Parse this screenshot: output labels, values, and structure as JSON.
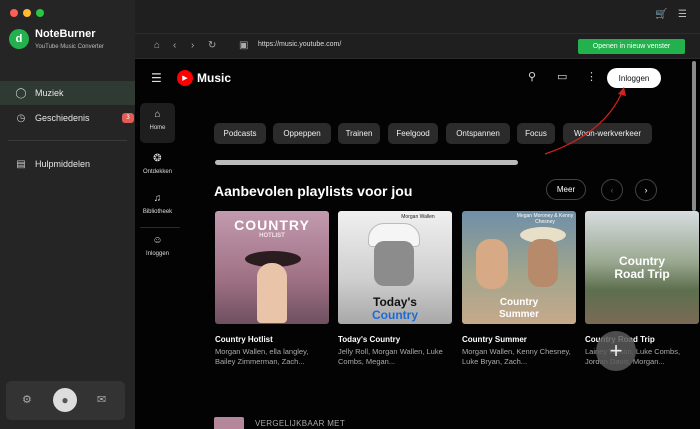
{
  "window": {
    "traffic_colors": [
      "#ff5f57",
      "#febc2e",
      "#28c840"
    ]
  },
  "app": {
    "name": "NoteBurner",
    "subtitle": "YouTube Music Converter",
    "logo_letter": "d",
    "accent": "#22b14c"
  },
  "sidebar": {
    "items": [
      {
        "label": "Muziek",
        "icon": "headphones-icon",
        "active": true
      },
      {
        "label": "Geschiedenis",
        "icon": "clock-icon",
        "badge": "3"
      },
      {
        "label": "Hulpmiddelen",
        "icon": "toolbox-icon"
      }
    ]
  },
  "bottombar": {
    "icons": [
      "settings-icon",
      "avatar",
      "mail-icon"
    ]
  },
  "wintop": {
    "icons": [
      "cart-icon",
      "menu-icon"
    ]
  },
  "browser": {
    "url": "https://music.youtube.com/",
    "open_button": "Openen in nieuw venster"
  },
  "yt": {
    "logo_text": "Music",
    "login": "Inloggen",
    "nav": [
      {
        "label": "Home",
        "icon": "home-icon"
      },
      {
        "label": "Ontdekken",
        "icon": "compass-icon"
      },
      {
        "label": "Bibliotheek",
        "icon": "library-icon"
      },
      {
        "label": "Inloggen",
        "icon": "account-icon"
      }
    ],
    "chips": [
      "Podcasts",
      "Oppeppen",
      "Trainen",
      "Feelgood",
      "Ontspannen",
      "Focus",
      "Woon-werkverkeer"
    ],
    "section_title": "Aanbevolen playlists voor jou",
    "more_button": "Meer",
    "cards": [
      {
        "title": "Country Hotlist",
        "subtitle": "Morgan Wallen, ella langley, Bailey Zimmerman, Zach...",
        "cover_text": "COUNTRY",
        "cover_sub": "HOTLIST",
        "cover_color": "#b38a9c"
      },
      {
        "title": "Today's Country",
        "subtitle": "Jelly Roll, Morgan Wallen, Luke Combs, Megan...",
        "cover_text": "Today's",
        "cover_text2": "Country",
        "cover_top": "Morgan Wallen",
        "cover_color": "#d9d9d9"
      },
      {
        "title": "Country Summer",
        "subtitle": "Morgan Wallen, Kenny Chesney, Luke Bryan, Zach...",
        "cover_text": "Country",
        "cover_text2": "Summer",
        "cover_top": "Megan Moroney & Kenny Chesney",
        "cover_color": "#7b8f9c"
      },
      {
        "title": "Country Road Trip",
        "subtitle": "Lainey Wilson, Luke Combs, Jordan Davis, Morgan...",
        "cover_text": "Country",
        "cover_text2": "Road Trip",
        "cover_color": "#8a9e7a"
      }
    ],
    "next_section": "VERGELIJKBAAR MET"
  }
}
